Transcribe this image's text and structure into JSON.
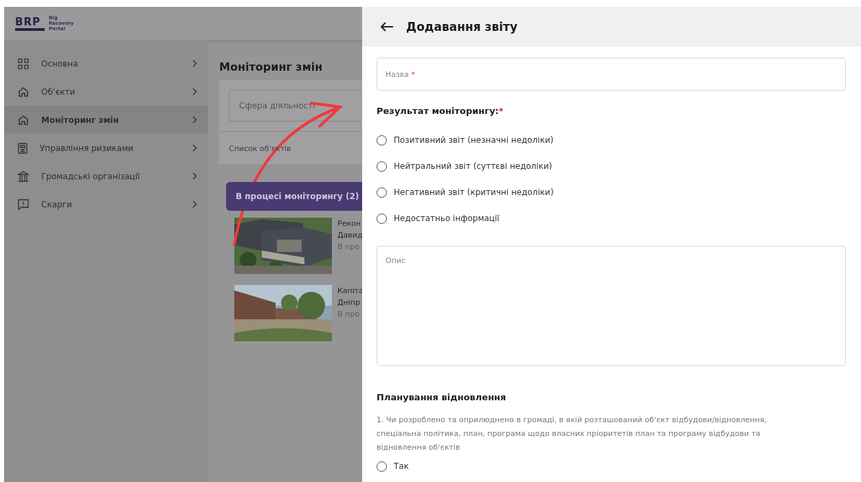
{
  "logo": {
    "abbr": "BRP",
    "name": [
      "Big",
      "Recovery",
      "Portal"
    ]
  },
  "sidebar": {
    "items": [
      {
        "label": "Основна",
        "selected": false
      },
      {
        "label": "Обʼєкти",
        "selected": false
      },
      {
        "label": "Моніторинг змін",
        "selected": true
      },
      {
        "label": "Управління ризиками",
        "selected": false
      },
      {
        "label": "Громадські організації",
        "selected": false
      },
      {
        "label": "Скарги",
        "selected": false
      }
    ]
  },
  "content": {
    "title": "Моніторинг змін",
    "filter": {
      "placeholder": "Сфера діяльності"
    },
    "tab": "Список обʼєктів",
    "group": "В процесі моніторингу (2)",
    "objects": [
      {
        "kind": "picture",
        "title": "Рекон",
        "place": "Давид",
        "status": "В про"
      },
      {
        "kind": "picture",
        "title": "Капіта",
        "place": "Дніпр",
        "status": "В про"
      }
    ]
  },
  "panel": {
    "title": "Додавання звіту",
    "name_field": {
      "placeholder": "Назва",
      "required_mark": "*"
    },
    "result": {
      "label": "Результат моніторингу:",
      "required_mark": "*",
      "options": [
        {
          "label": "Позитивний звіт (незначні недоліки)",
          "selected": false
        },
        {
          "label": "Нейтральний звіт (суттєві недоліки)",
          "selected": false
        },
        {
          "label": "Негативний звіт (критичні недоліки)",
          "selected": false
        },
        {
          "label": "Недостатньо інформації",
          "selected": false
        }
      ]
    },
    "description": {
      "placeholder": "Опис"
    },
    "section": "Планування відновлення",
    "question": "1. Чи розроблено та оприлюднено в громаді, в якій розташований обʼєкт відбудови/відновлення, спеціальна політика, план, програма щодо власних пріоритетів план та програму відбудови та відновлення обʼєктів",
    "answers": [
      {
        "label": "Так",
        "selected": false
      }
    ]
  }
}
